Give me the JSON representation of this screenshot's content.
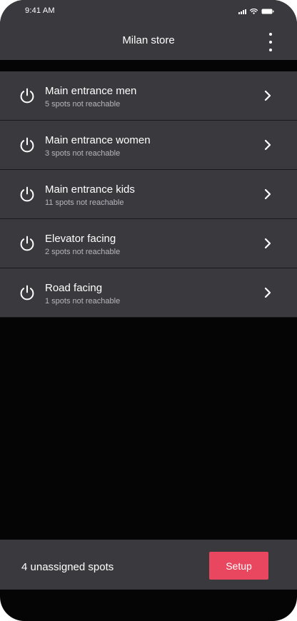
{
  "status_bar": {
    "time": "9:41 AM",
    "icons": [
      "signal-icon",
      "wifi-icon",
      "battery-icon"
    ]
  },
  "header": {
    "title": "Milan store",
    "menu_icon": "more-vertical-icon"
  },
  "zones": [
    {
      "name": "Main entrance men",
      "status": "5 spots not reachable"
    },
    {
      "name": "Main entrance women",
      "status": "3 spots not reachable"
    },
    {
      "name": "Main entrance kids",
      "status": "11 spots not reachable"
    },
    {
      "name": "Elevator facing",
      "status": "2 spots not reachable"
    },
    {
      "name": "Road facing",
      "status": "1 spots not reachable"
    }
  ],
  "footer": {
    "unassigned_text": "4 unassigned spots",
    "setup_label": "Setup"
  },
  "colors": {
    "background": "#050505",
    "surface": "#3a393e",
    "accent": "#e8475f",
    "text_primary": "#ffffff",
    "text_secondary": "#b7b6bb"
  }
}
